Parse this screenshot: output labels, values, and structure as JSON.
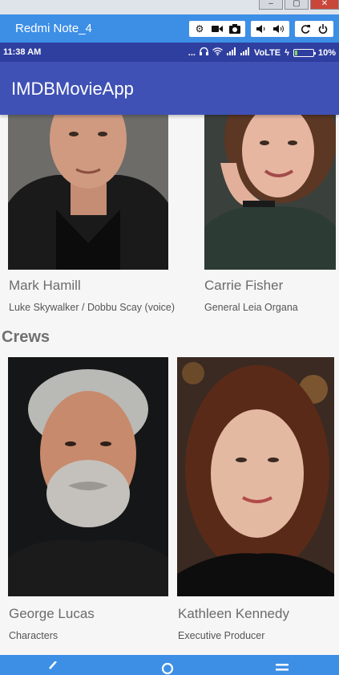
{
  "emulator": {
    "device_name": "Redmi Note_4"
  },
  "status_bar": {
    "time": "11:38 AM",
    "dots": "...",
    "network": "VoLTE",
    "battery": "10%"
  },
  "app_bar": {
    "title": "IMDBMovieApp"
  },
  "cast": [
    {
      "name": "Mark Hamill",
      "role": "Luke Skywalker / Dobbu Scay (voice)"
    },
    {
      "name": "Carrie Fisher",
      "role": "General Leia Organa"
    }
  ],
  "crews_section": {
    "title": "Crews",
    "members": [
      {
        "name": "George Lucas",
        "role": "Characters"
      },
      {
        "name": "Kathleen Kennedy",
        "role": "Executive Producer"
      }
    ]
  },
  "colors": {
    "app_bar": "#3f51b5",
    "status_bar": "#2f3fa0",
    "emulator_bar": "#3d8fe6"
  }
}
